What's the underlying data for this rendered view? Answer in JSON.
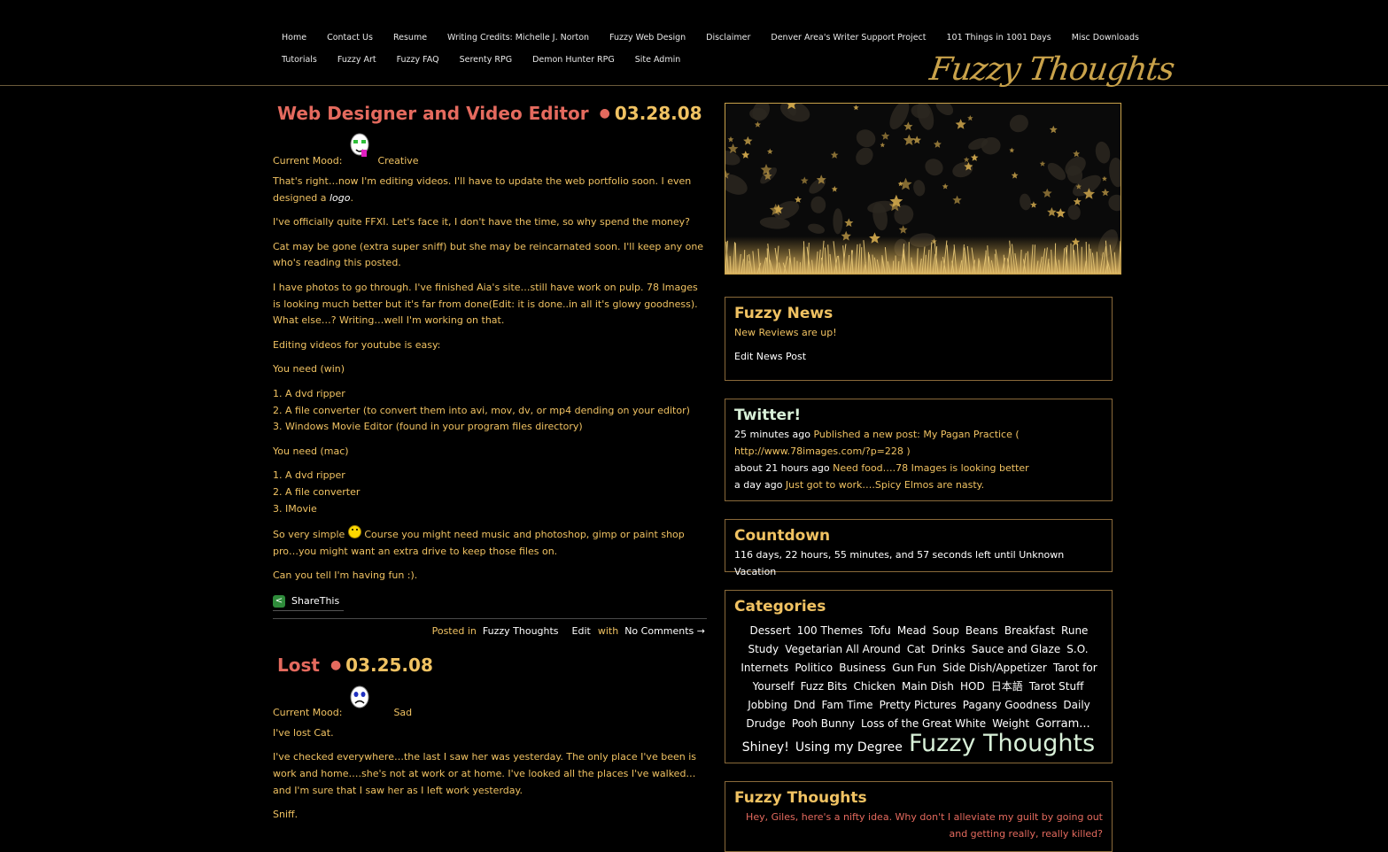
{
  "nav": {
    "row1": [
      "Home",
      "Contact Us",
      "Resume",
      "Writing Credits: Michelle J. Norton",
      "Fuzzy Web Design",
      "Disclaimer",
      "Denver Area's Writer Support Project",
      "101 Things in 1001 Days",
      "Misc Downloads"
    ],
    "row2": [
      "Tutorials",
      "Fuzzy Art",
      "Fuzzy FAQ",
      "Serenty RPG",
      "Demon Hunter RPG",
      "Site Admin"
    ]
  },
  "site_logo": "Fuzzy Thoughts",
  "posts": [
    {
      "title": "Web Designer and Video Editor",
      "date": "03.28.08",
      "mood_label": "Current Mood:",
      "mood": "Creative",
      "p1a": "That's right…now I'm editing videos. I'll have to update the web portfolio soon. I even designed a ",
      "p1_link": "logo",
      "p1b": ".",
      "p2": "I've officially quite FFXI. Let's face it, I don't have the time, so why spend the money?",
      "p3": "Cat may be gone (extra super sniff) but she may be reincarnated soon. I'll keep any one who's reading this posted.",
      "p4": "I have photos to go through. I've finished Aia's site…still have work on pulp. 78 Images is looking much better but it's far from done(Edit: it is done..in all it's glowy goodness). What else…? Writing…well I'm working on that.",
      "p5": "Editing videos for youtube is easy:",
      "p6": "You need (win)",
      "win_list": [
        "1. A dvd ripper",
        "2. A file converter (to convert them into avi, mov, dv, or mp4 dending on your editor)",
        "3. Windows Movie Editor (found in your program files directory)"
      ],
      "p7": "You need (mac)",
      "mac_list": [
        "1. A dvd ripper",
        "2. A file converter",
        "3. IMovie"
      ],
      "p8a": "So very simple ",
      "p8b": " Course you might need music and photoshop, gimp or paint shop pro…you might want an extra drive to keep those files on.",
      "p9": "Can you tell I'm having fun :).",
      "share_label": "ShareThis",
      "meta_posted": "Posted in",
      "meta_category": "Fuzzy Thoughts",
      "meta_edit": "Edit",
      "meta_with": "with",
      "meta_comments": "No Comments →"
    },
    {
      "title": "Lost",
      "date": "03.25.08",
      "mood_label": "Current Mood:",
      "mood": "Sad",
      "p1": "I've lost Cat.",
      "p2": "I've checked everywhere…the last I saw her was yesterday. The only place I've been is work and home….she's not at work or at home. I've looked all the places I've walked…and I'm sure that I saw her as I left work yesterday.",
      "p3": "Sniff."
    }
  ],
  "sidebar": {
    "news": {
      "title": "Fuzzy News",
      "item": "New Reviews are up!",
      "edit": "Edit News Post"
    },
    "twitter": {
      "title": "Twitter!",
      "tweets": [
        {
          "time": "25 minutes ago",
          "text": "Published a new post: My Pagan Practice ( http://www.78images.com/?p=228 )"
        },
        {
          "time": "about 21 hours ago",
          "text": "Need food….78 Images is looking better"
        },
        {
          "time": "a day ago",
          "text": "Just got to work….Spicy Elmos are nasty."
        }
      ]
    },
    "countdown": {
      "title": "Countdown",
      "text": "116 days, 22 hours, 55 minutes, and 57 seconds left until Unknown Vacation"
    },
    "categories": {
      "title": "Categories",
      "tags": [
        "Dessert",
        "100 Themes",
        "Tofu",
        "Mead",
        "Soup",
        "Beans",
        "Breakfast",
        "Rune Study",
        "Vegetarian All Around",
        "Cat",
        "Drinks",
        "Sauce and Glaze",
        "S.O.",
        "Internets",
        "Politico",
        "Business",
        "Gun Fun",
        "Side Dish/Appetizer",
        "Tarot for Yourself",
        "Fuzz Bits",
        "Chicken",
        "Main Dish",
        "HOD",
        "日本語",
        "Tarot Stuff",
        "Jobbing",
        "Dnd",
        "Fam Time",
        "Pretty Pictures",
        "Pagany Goodness",
        "Daily Drudge",
        "Pooh Bunny",
        "Loss of the Great White",
        "Weight",
        "Gorram...",
        "Shiney!",
        "Using my Degree",
        "Fuzzy Thoughts"
      ]
    },
    "fuzzy_thoughts": {
      "title": "Fuzzy Thoughts",
      "quote": "Hey, Giles, here's a nifty idea. Why don't I alleviate my guilt by going out and getting really, really killed?"
    }
  },
  "colors": {
    "background": "#000000",
    "text": "#f0c262",
    "title_red": "#e46a5e",
    "accent_gold": "#c9a24a"
  }
}
